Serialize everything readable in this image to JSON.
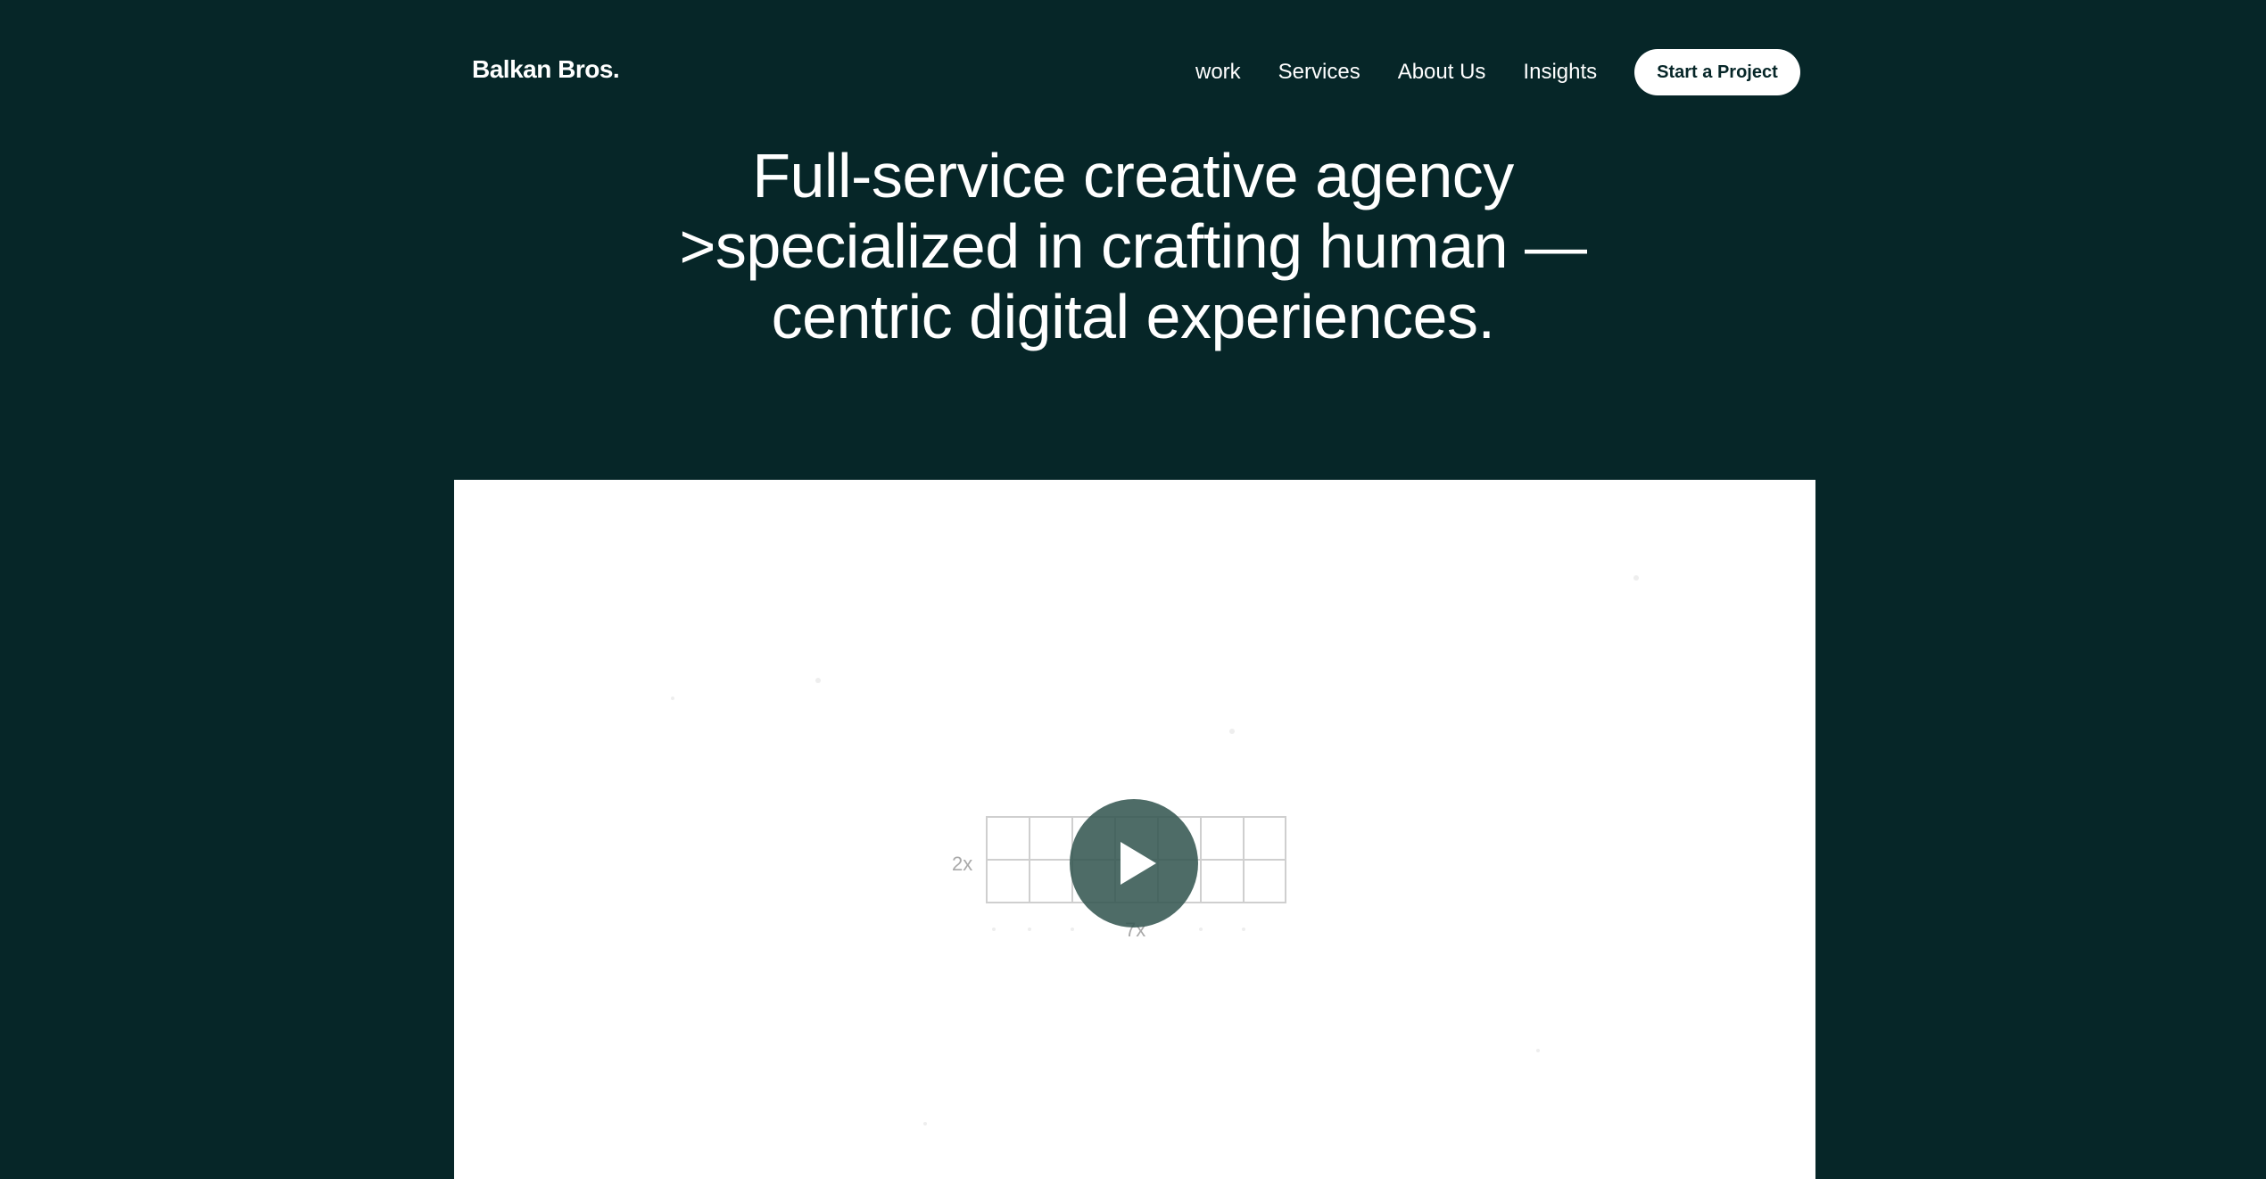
{
  "header": {
    "logo": "Balkan Bros.",
    "nav": [
      {
        "label": "work"
      },
      {
        "label": "Services"
      },
      {
        "label": "About Us"
      },
      {
        "label": "Insights"
      }
    ],
    "cta_label": "Start a Project"
  },
  "hero": {
    "lines": [
      "Full-service creative agency",
      ">specialized in crafting human —",
      "centric digital experiences."
    ]
  },
  "video": {
    "grid_label_left": "2x",
    "grid_label_bottom": "7x",
    "play_icon": "play-icon"
  },
  "colors": {
    "background": "#062628",
    "text": "#ffffff",
    "button_bg": "#ffffff",
    "play_button": "#365852",
    "video_bg": "#ffffff"
  }
}
